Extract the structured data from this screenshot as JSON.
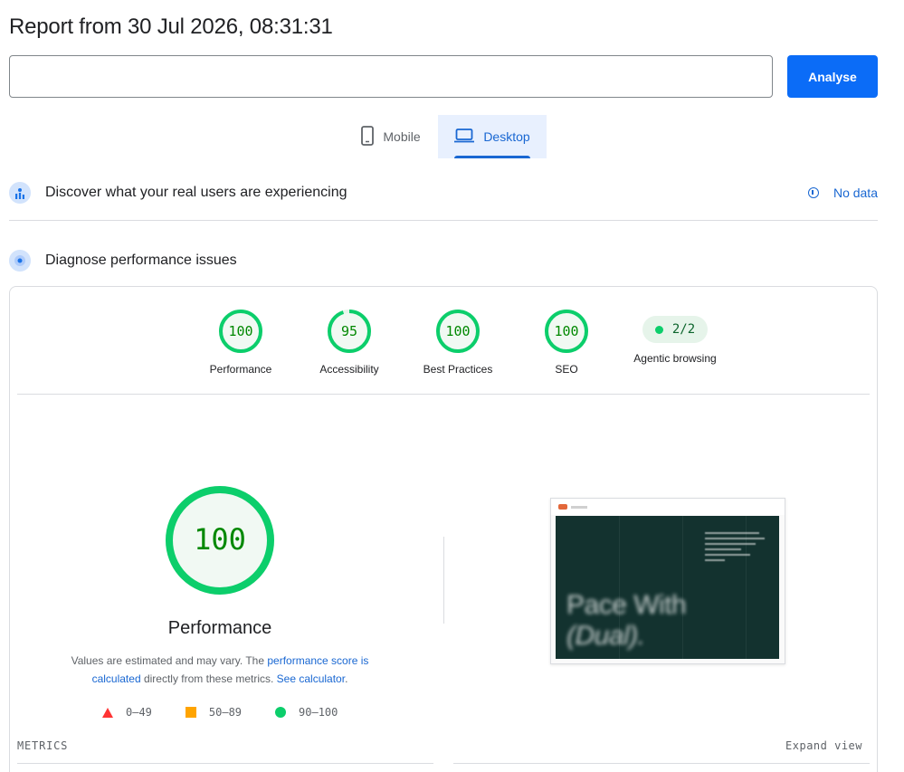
{
  "header": {
    "title": "Report from 30 Jul 2026, 08:31:31"
  },
  "url_input": {
    "value": "",
    "placeholder": ""
  },
  "analyse_button": {
    "label": "Analyse"
  },
  "device_tabs": [
    {
      "label": "Mobile",
      "icon": "smartphone-icon",
      "active": false
    },
    {
      "label": "Desktop",
      "icon": "laptop-icon",
      "active": true
    }
  ],
  "field_data": {
    "title": "Discover what your real users are experiencing",
    "status": "No data",
    "icon": "crux-users-icon"
  },
  "lab_data": {
    "title": "Diagnose performance issues",
    "icon": "lighthouse-icon"
  },
  "scores": [
    {
      "label": "Performance",
      "value": "100",
      "score": 100
    },
    {
      "label": "Accessibility",
      "value": "95",
      "score": 95
    },
    {
      "label": "Best Practices",
      "value": "100",
      "score": 100
    },
    {
      "label": "SEO",
      "value": "100",
      "score": 100
    }
  ],
  "agentic": {
    "label": "Agentic browsing",
    "value": "2/2"
  },
  "performance": {
    "score": 100,
    "score_text": "100",
    "title": "Performance",
    "desc_prefix": "Values are estimated and may vary. The ",
    "desc_link1": "performance score is calculated",
    "desc_middle": " directly from these metrics. ",
    "desc_link2": "See calculator",
    "desc_suffix": "."
  },
  "legend": [
    {
      "range": "0–49",
      "shape": "triangle",
      "color": "#ff3333"
    },
    {
      "range": "50–89",
      "shape": "square",
      "color": "#ffa400"
    },
    {
      "range": "90–100",
      "shape": "circle",
      "color": "#0cce6b"
    }
  ],
  "screenshot": {
    "hero_text_line1": "Pace With",
    "hero_text_line2": "(Dual)."
  },
  "metrics": {
    "label": "METRICS",
    "expand_label": "Expand view"
  },
  "colors": {
    "pass": "#0cce6b",
    "pass_text": "#008800",
    "pass_bg": "#e6f4ea",
    "accent": "#1967d2",
    "button": "#0b6cf7"
  }
}
